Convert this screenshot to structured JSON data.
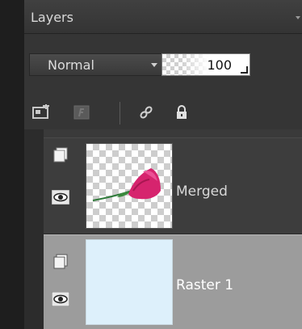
{
  "panel": {
    "title": "Layers"
  },
  "controls": {
    "blend_mode": "Normal",
    "opacity": "100"
  },
  "toolbar": {
    "icons": [
      "new-raster-layer-icon",
      "mask-icon",
      "link-icon",
      "lock-icon"
    ]
  },
  "layers": [
    {
      "name": "Merged",
      "visible": true,
      "thumbnail": "rose-on-transparent"
    },
    {
      "name": "Raster 1",
      "visible": true,
      "selected": true,
      "thumbnail": "solid-light-blue"
    }
  ],
  "colors": {
    "panel_bg": "#3a3a3a",
    "selected_row": "#9c9c9c",
    "raster_thumb": "#ddf0fb",
    "rose": "#d6246e"
  }
}
